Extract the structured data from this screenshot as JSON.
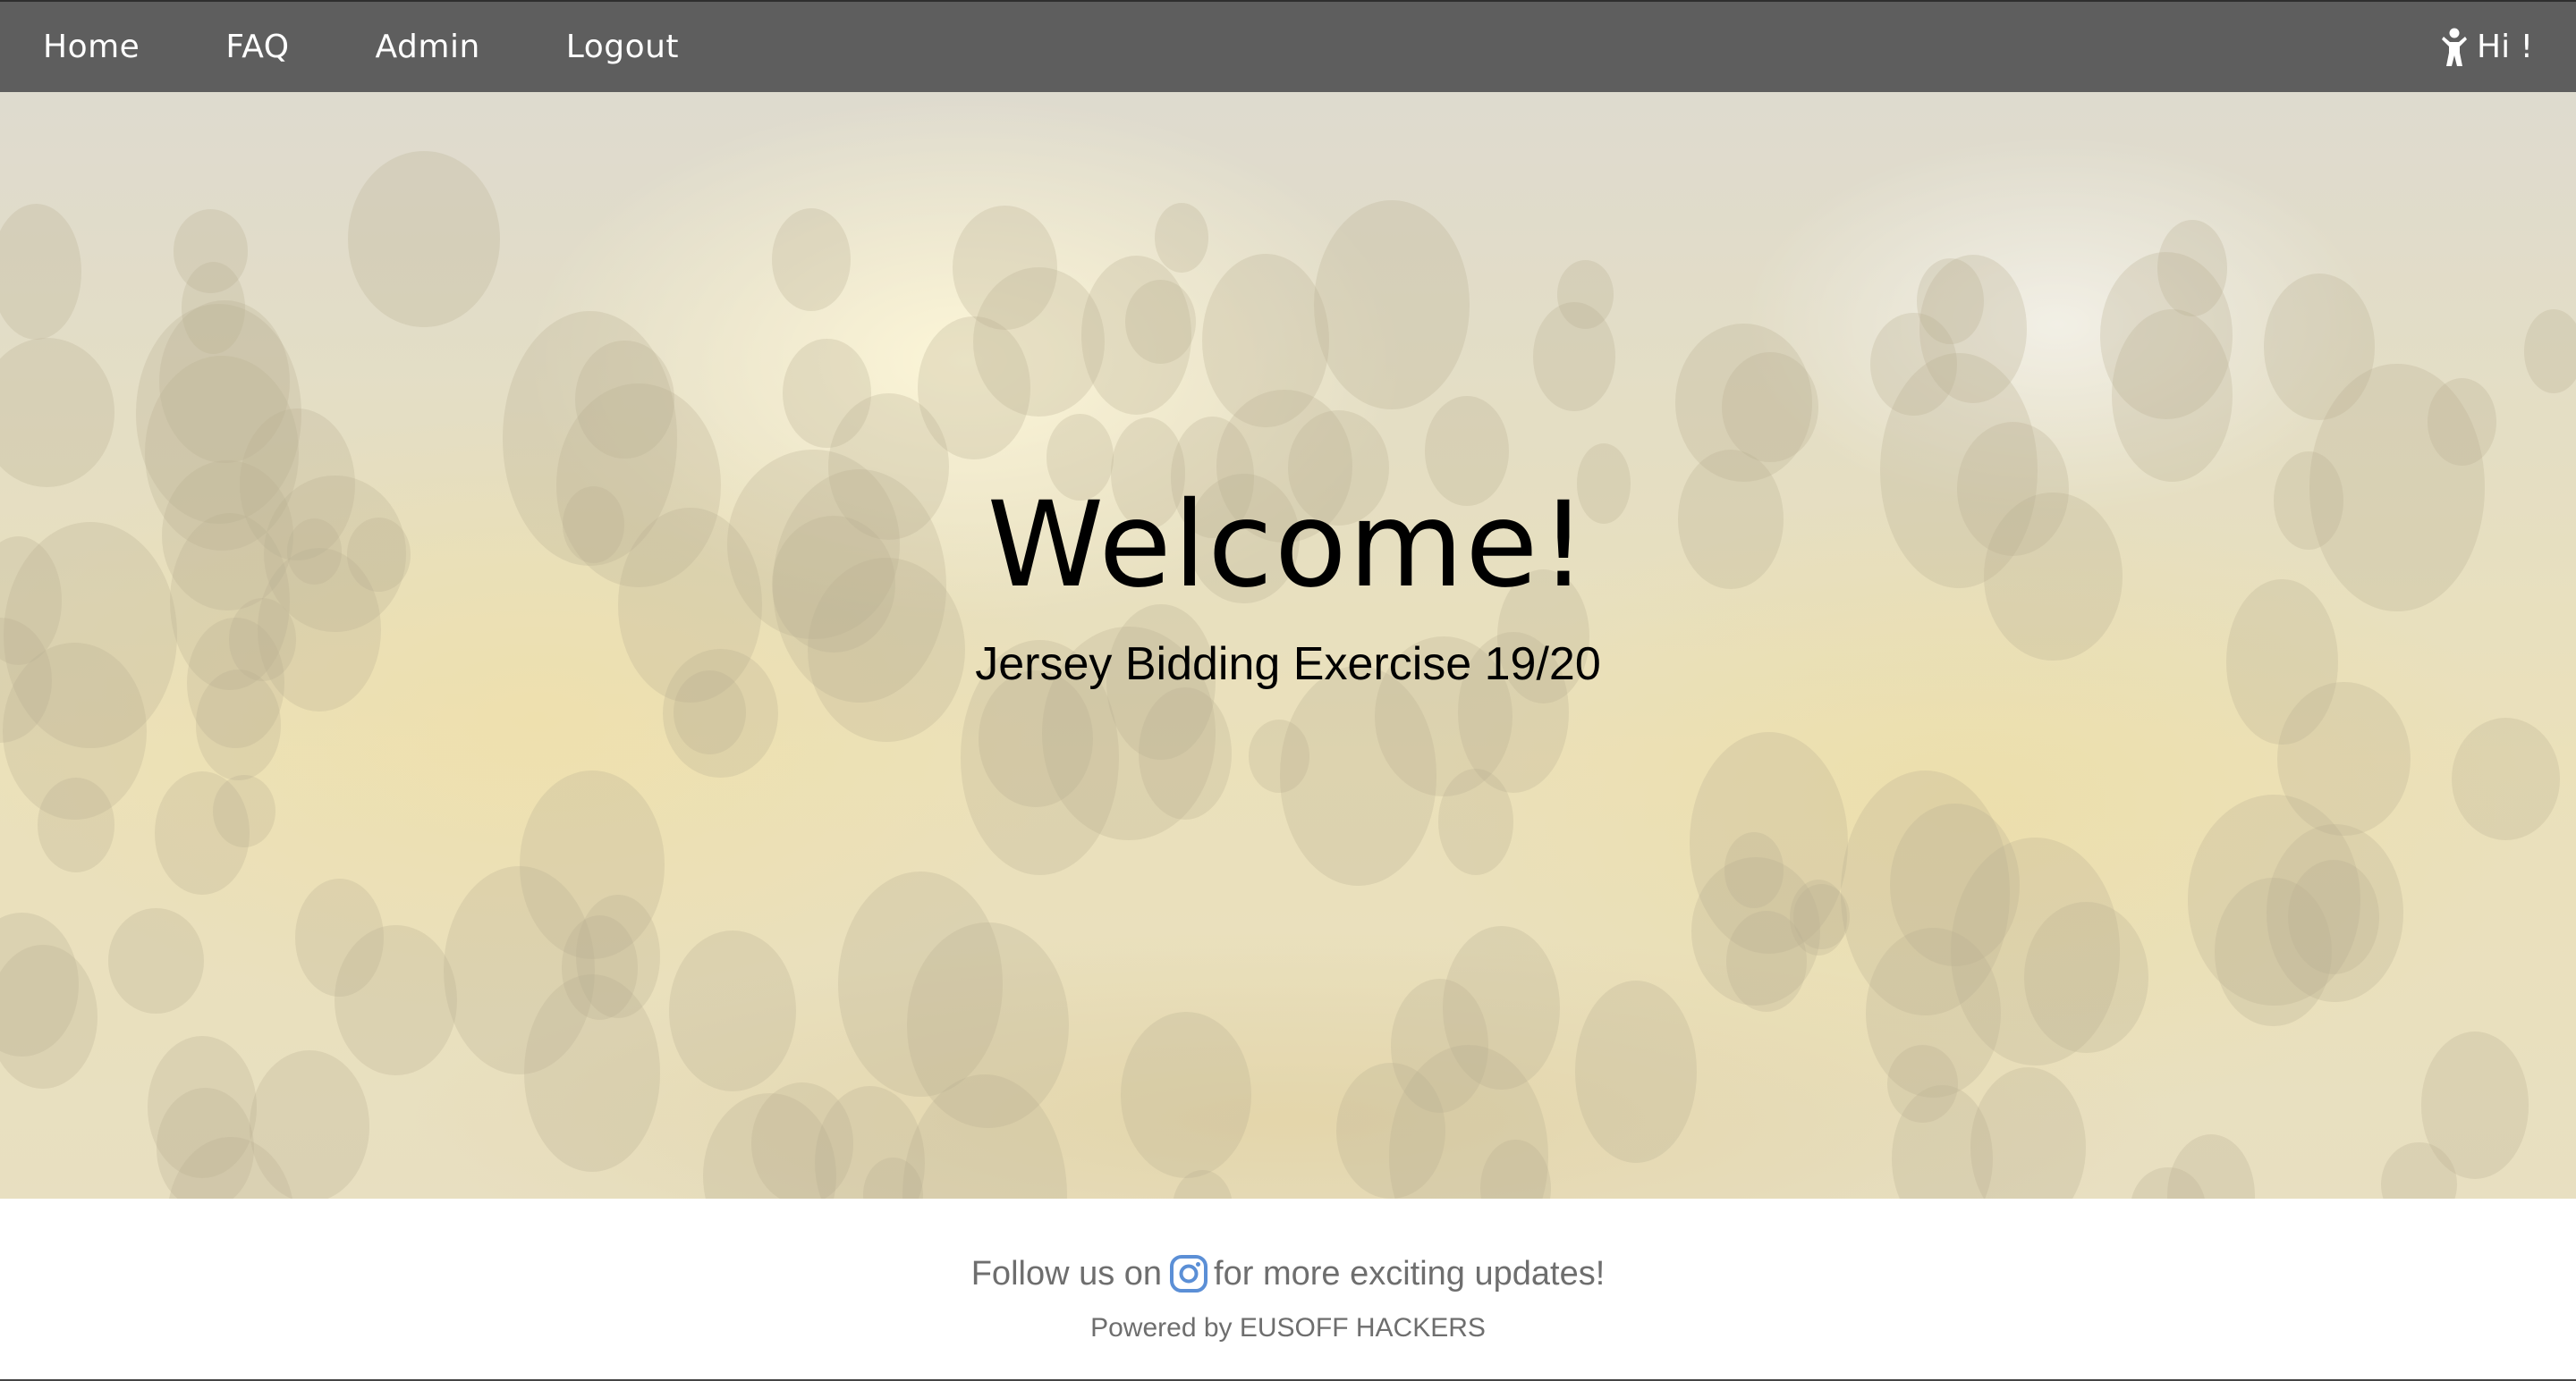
{
  "nav": {
    "links": [
      {
        "label": "Home"
      },
      {
        "label": "FAQ"
      },
      {
        "label": "Admin"
      },
      {
        "label": "Logout"
      }
    ],
    "user_greeting": "Hi !",
    "user_icon": "person-icon"
  },
  "hero": {
    "title": "Welcome!",
    "subtitle": "Jersey Bidding Exercise 19/20"
  },
  "footer": {
    "follow_prefix": "Follow us on",
    "follow_suffix": "for more exciting updates!",
    "social_icon": "instagram-icon",
    "powered_by": "Powered by EUSOFF HACKERS"
  },
  "colors": {
    "navbar_bg": "#5e5e5e",
    "footer_text": "#6e6e6e",
    "instagram_accent": "#5b8fd6"
  }
}
